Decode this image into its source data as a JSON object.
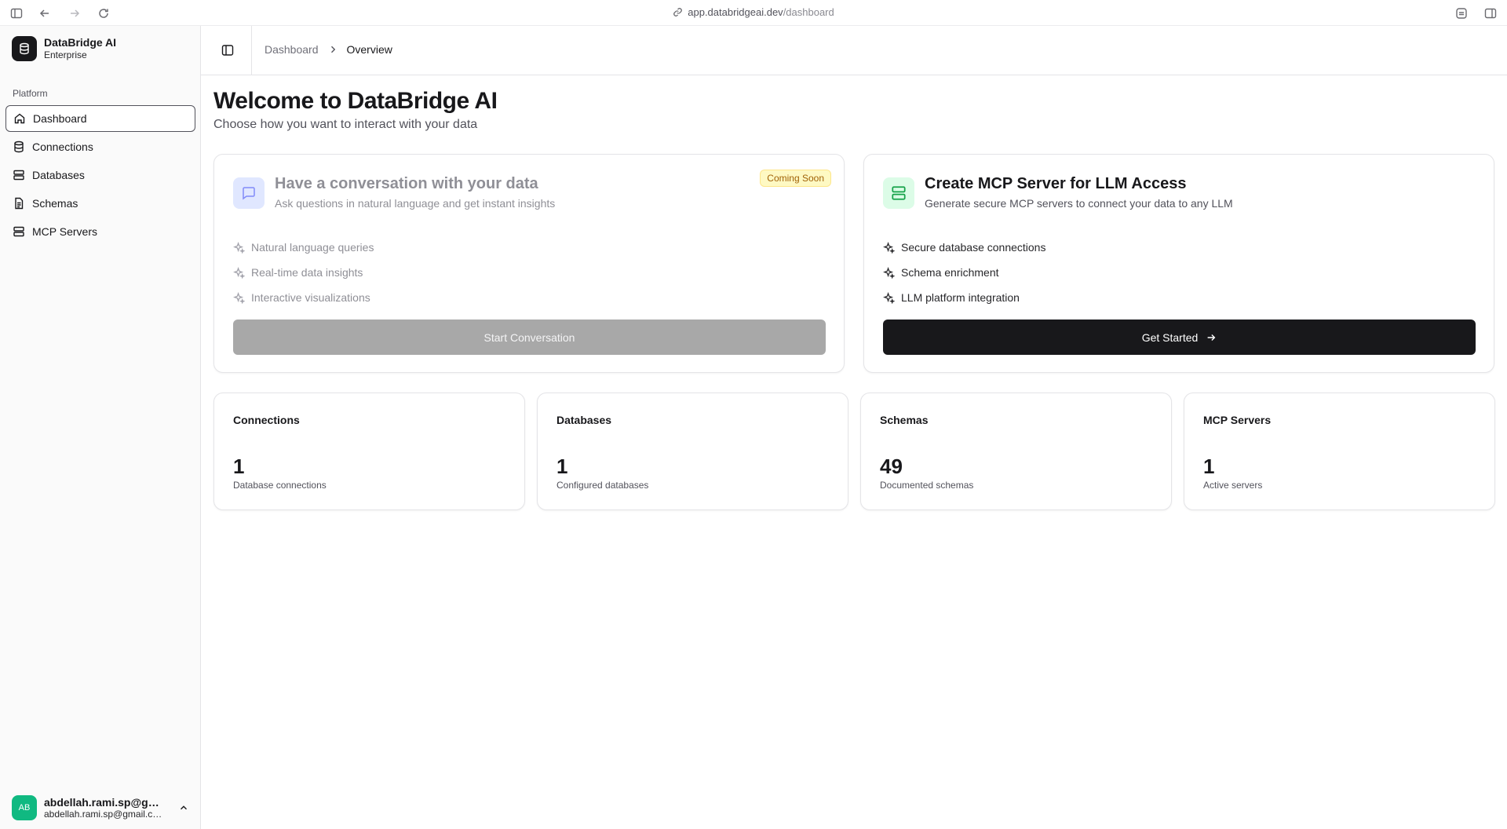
{
  "browser": {
    "url_host": "app.databridgeai.dev",
    "url_path": "/dashboard"
  },
  "sidebar": {
    "brand_name": "DataBridge AI",
    "brand_plan": "Enterprise",
    "section_label": "Platform",
    "items": [
      {
        "label": "Dashboard",
        "icon": "home-icon",
        "active": true
      },
      {
        "label": "Connections",
        "icon": "database-icon"
      },
      {
        "label": "Databases",
        "icon": "server-icon"
      },
      {
        "label": "Schemas",
        "icon": "file-text-icon"
      },
      {
        "label": "MCP Servers",
        "icon": "server-icon"
      }
    ],
    "user": {
      "initials": "AB",
      "name": "abdellah.rami.sp@gmail.com",
      "email": "abdellah.rami.sp@gmail.com"
    }
  },
  "header": {
    "breadcrumb_parent": "Dashboard",
    "breadcrumb_current": "Overview"
  },
  "main": {
    "title": "Welcome to DataBridge AI",
    "subtitle": "Choose how you want to interact with your data",
    "cards": {
      "conversation": {
        "title": "Have a conversation with your data",
        "description": "Ask questions in natural language and get instant insights",
        "badge": "Coming Soon",
        "features": [
          "Natural language queries",
          "Real-time data insights",
          "Interactive visualizations"
        ],
        "button": "Start Conversation"
      },
      "mcp": {
        "title": "Create MCP Server for LLM Access",
        "description": "Generate secure MCP servers to connect your data to any LLM",
        "features": [
          "Secure database connections",
          "Schema enrichment",
          "LLM platform integration"
        ],
        "button": "Get Started"
      }
    },
    "stats": [
      {
        "title": "Connections",
        "value": "1",
        "caption": "Database connections"
      },
      {
        "title": "Databases",
        "value": "1",
        "caption": "Configured databases"
      },
      {
        "title": "Schemas",
        "value": "49",
        "caption": "Documented schemas"
      },
      {
        "title": "MCP Servers",
        "value": "1",
        "caption": "Active servers"
      }
    ]
  },
  "colors": {
    "accent": "#18181b",
    "avatar": "#10b981",
    "badge_bg": "#fef9c3",
    "badge_text": "#a16207",
    "mcp_icon_bg": "#dcfce7",
    "mcp_icon": "#16a34a",
    "chat_icon_bg": "#e0e7ff",
    "chat_icon": "#6366f1"
  }
}
